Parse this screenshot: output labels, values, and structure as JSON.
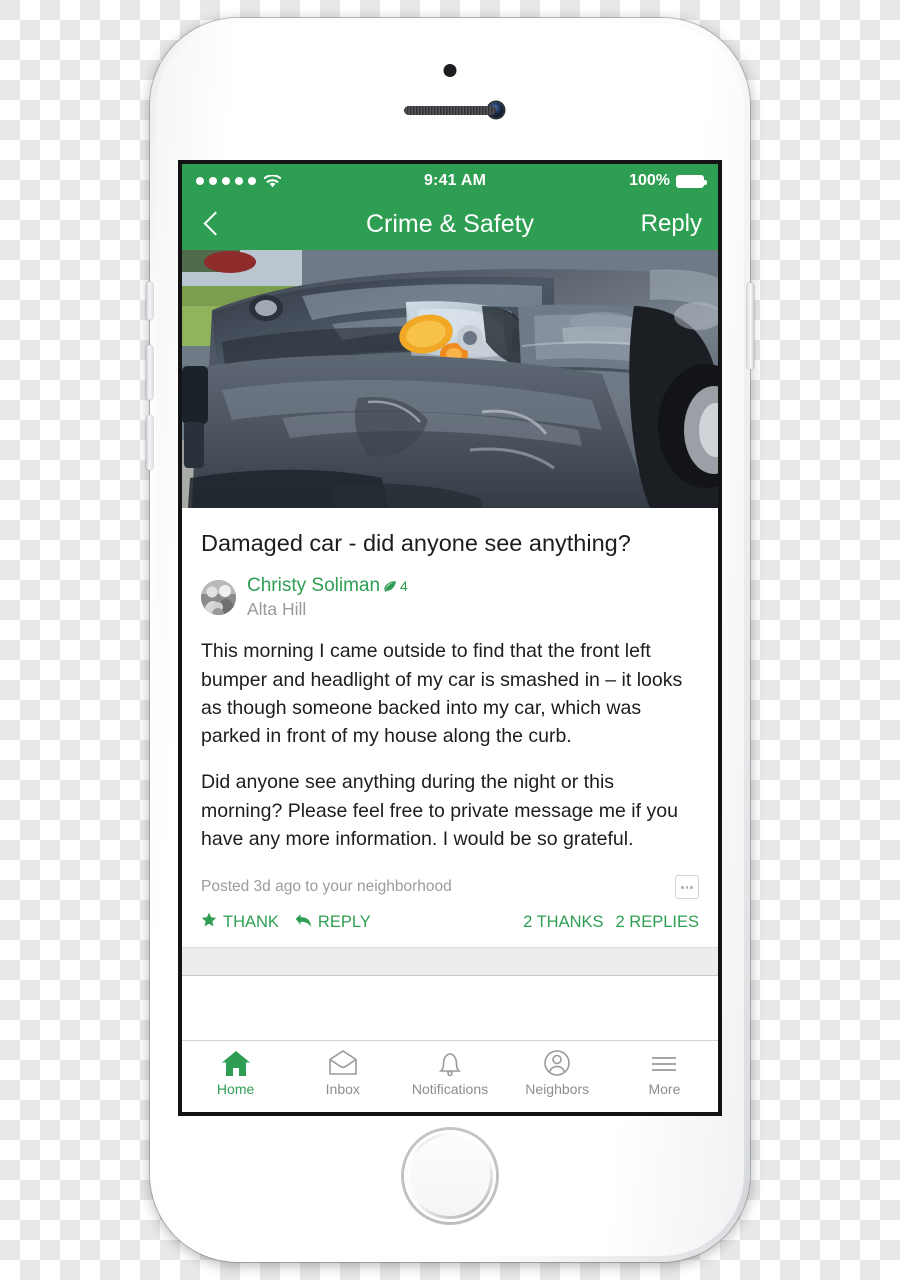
{
  "device": {
    "kind": "white-smartphone"
  },
  "status_bar": {
    "signal_dots": 5,
    "wifi_icon": "wifi-icon",
    "time": "9:41 AM",
    "battery_percent": "100%",
    "battery_icon": "battery-full-icon"
  },
  "nav_bar": {
    "back_icon": "chevron-left-icon",
    "title": "Crime & Safety",
    "action_label": "Reply"
  },
  "post": {
    "photo_alt": "damaged-car-front-bumper-photo",
    "title": "Damaged car - did anyone see anything?",
    "author": {
      "avatar": "user-avatar",
      "name": "Christy Soliman",
      "badge_icon": "leaf-icon",
      "badge_count": "4",
      "neighborhood": "Alta Hill"
    },
    "paragraphs": [
      "This morning I came outside to find that the front left bumper and headlight of my car is smashed in – it looks as though someone backed into my car, which was parked in front of my house along the curb.",
      "Did anyone see anything during the night or this morning? Please feel free to private message me if you have any more information. I would be so grateful."
    ],
    "posted_meta": "Posted 3d ago to your neighborhood",
    "overflow_icon": "ellipsis-icon",
    "actions": {
      "thank_icon": "star-icon",
      "thank_label": "THANK",
      "reply_icon": "reply-arrow-icon",
      "reply_label": "REPLY",
      "thanks_count": "2 THANKS",
      "replies_count": "2 REPLIES"
    }
  },
  "tab_bar": {
    "items": [
      {
        "label": "Home",
        "icon": "home-icon",
        "active": true
      },
      {
        "label": "Inbox",
        "icon": "inbox-icon",
        "active": false
      },
      {
        "label": "Notifications",
        "icon": "bell-icon",
        "active": false
      },
      {
        "label": "Neighbors",
        "icon": "person-circle-icon",
        "active": false
      },
      {
        "label": "More",
        "icon": "hamburger-icon",
        "active": false
      }
    ]
  },
  "colors": {
    "brand_green": "#2e9e53",
    "text_primary": "#1d1d1d",
    "text_muted": "#9b9b9b",
    "tab_inactive": "#8d8d8d"
  }
}
